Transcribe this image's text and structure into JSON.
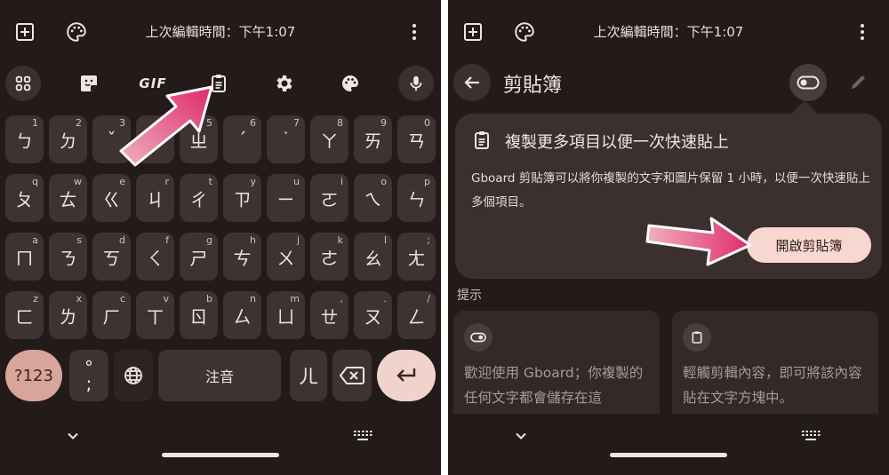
{
  "left": {
    "status": {
      "title": "上次編輯時間：下午1:07"
    },
    "toolbar": {
      "gif_label": "GIF"
    },
    "rows": [
      [
        {
          "c": "ㄅ",
          "h": "1"
        },
        {
          "c": "ㄉ",
          "h": "2"
        },
        {
          "c": "ˇ",
          "h": "3"
        },
        {
          "c": "ˋ",
          "h": "4"
        },
        {
          "c": "ㄓ",
          "h": "5"
        },
        {
          "c": "ˊ",
          "h": "6"
        },
        {
          "c": "˙",
          "h": "7"
        },
        {
          "c": "ㄚ",
          "h": "8"
        },
        {
          "c": "ㄞ",
          "h": "9"
        },
        {
          "c": "ㄢ",
          "h": "0"
        }
      ],
      [
        {
          "c": "ㄆ",
          "h": "q"
        },
        {
          "c": "ㄊ",
          "h": "w"
        },
        {
          "c": "ㄍ",
          "h": "e"
        },
        {
          "c": "ㄐ",
          "h": "r"
        },
        {
          "c": "ㄔ",
          "h": "t"
        },
        {
          "c": "ㄗ",
          "h": "y"
        },
        {
          "c": "ㄧ",
          "h": "u"
        },
        {
          "c": "ㄛ",
          "h": "i"
        },
        {
          "c": "ㄟ",
          "h": "o"
        },
        {
          "c": "ㄣ",
          "h": "p"
        }
      ],
      [
        {
          "c": "ㄇ",
          "h": "a"
        },
        {
          "c": "ㄋ",
          "h": "s"
        },
        {
          "c": "ㄎ",
          "h": "d"
        },
        {
          "c": "ㄑ",
          "h": "f"
        },
        {
          "c": "ㄕ",
          "h": "g"
        },
        {
          "c": "ㄘ",
          "h": "h"
        },
        {
          "c": "ㄨ",
          "h": "j"
        },
        {
          "c": "ㄜ",
          "h": "k"
        },
        {
          "c": "ㄠ",
          "h": "l"
        },
        {
          "c": "ㄤ",
          "h": ";"
        }
      ],
      [
        {
          "c": "ㄈ",
          "h": "z"
        },
        {
          "c": "ㄌ",
          "h": "x"
        },
        {
          "c": "ㄏ",
          "h": "c"
        },
        {
          "c": "ㄒ",
          "h": "v"
        },
        {
          "c": "ㄖ",
          "h": "b"
        },
        {
          "c": "ㄙ",
          "h": "n"
        },
        {
          "c": "ㄩ",
          "h": "m"
        },
        {
          "c": "ㄝ",
          "h": ","
        },
        {
          "c": "ㄡ",
          "h": "."
        },
        {
          "c": "ㄥ",
          "h": "/"
        }
      ]
    ],
    "bottom": {
      "symbols_label": "?123",
      "punct_top": "°",
      "punct_bottom": ";",
      "space_label": "注音",
      "er_label": "ㄦ"
    }
  },
  "right": {
    "status": {
      "title": "上次編輯時間：下午1:07"
    },
    "header": {
      "title": "剪貼簿"
    },
    "card": {
      "title": "複製更多項目以便一次快速貼上",
      "description": "Gboard 剪貼簿可以將你複製的文字和圖片保留 1 小時，以便一次快速貼上多個項目。",
      "button": "開啟剪貼簿"
    },
    "tips_label": "提示",
    "tips": [
      {
        "text": "歡迎使用 Gboard；你複製的任何文字都會儲存在這"
      },
      {
        "text": "輕觸剪輯內容，即可將該內容貼在文字方塊中。"
      }
    ]
  },
  "colors": {
    "panel_bg": "#231b1a",
    "key_bg": "#3e3331",
    "accent_button": "#f7d7d0",
    "symbols_key": "#d7a59a",
    "arrow": "#e0306f"
  }
}
